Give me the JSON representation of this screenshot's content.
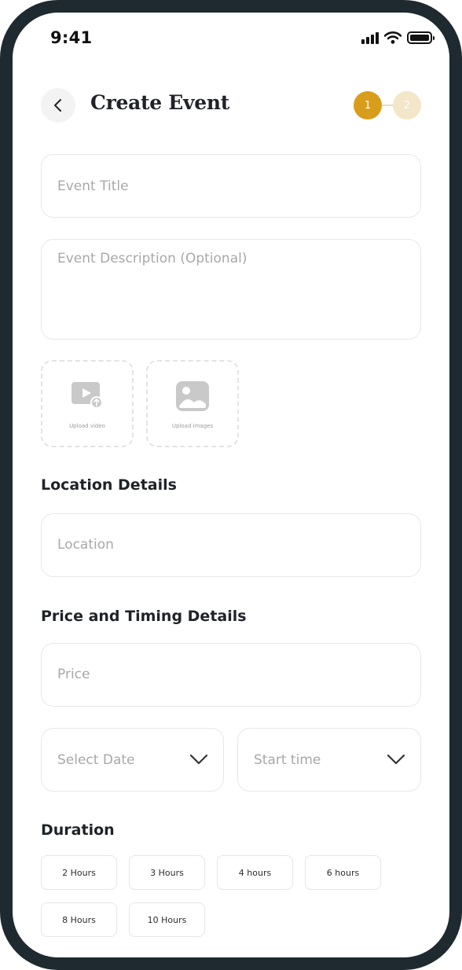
{
  "status_bar": {
    "time": "9:41"
  },
  "header": {
    "title": "Create Event",
    "steps": [
      "1",
      "2"
    ],
    "active_step": 1
  },
  "form": {
    "event_title_placeholder": "Event Title",
    "event_description_placeholder": "Event Description (Optional)",
    "upload_video_label": "Upload video",
    "upload_images_label": "Upload images",
    "location_section_title": "Location Details",
    "location_placeholder": "Location",
    "price_section_title": "Price and Timing Details",
    "price_placeholder": "Price",
    "select_date_placeholder": "Select Date",
    "start_time_placeholder": "Start time",
    "duration_section_title": "Duration",
    "durations": [
      "2 Hours",
      "3 Hours",
      "4 hours",
      "6 hours",
      "8 Hours",
      "10 Hours"
    ]
  },
  "colors": {
    "accent": "#d99d1c",
    "accent_light": "#f3e6c9",
    "frame": "#1f2a30",
    "placeholder": "#a8a8a8",
    "border": "#e8e8e8"
  },
  "icons": [
    "chevron-left-icon",
    "signal-icon",
    "wifi-icon",
    "battery-icon",
    "video-upload-icon",
    "image-icon",
    "chevron-down-icon"
  ]
}
